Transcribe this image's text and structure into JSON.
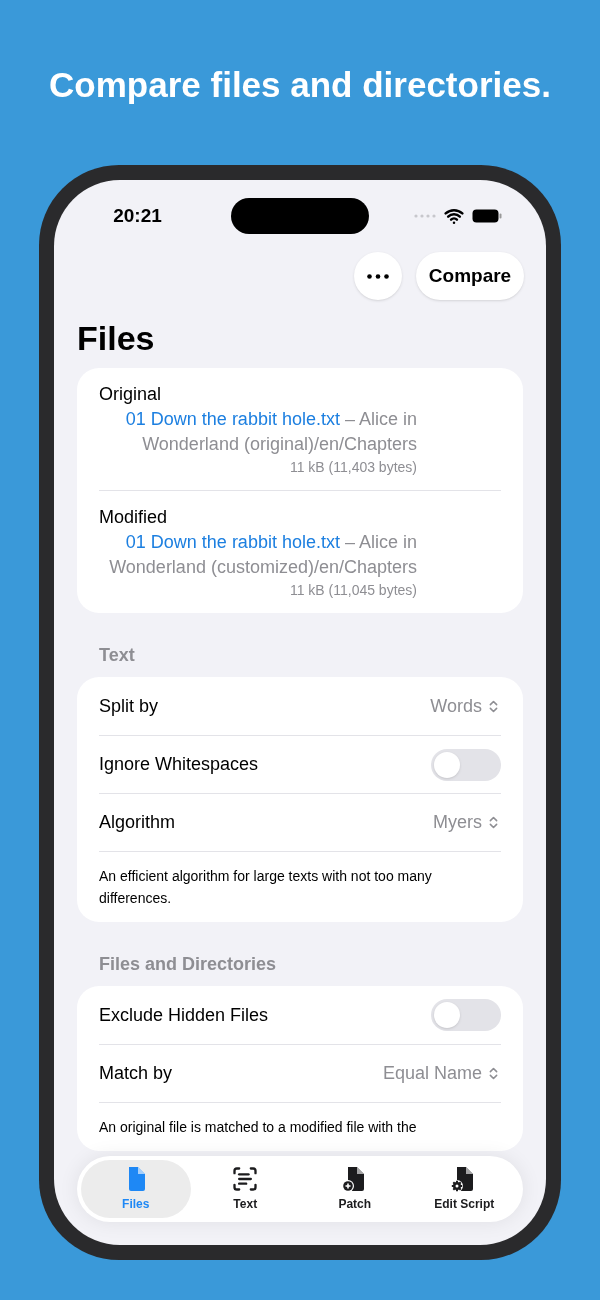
{
  "headline": "Compare files and directories.",
  "status_bar": {
    "time": "20:21"
  },
  "toolbar": {
    "compare_button": "Compare"
  },
  "title": "Files",
  "files": [
    {
      "label": "Original",
      "file_name": "01 Down the rabbit hole.txt",
      "path": " – Alice in Wonderland (original)/en/Chapters",
      "size": "11 kB (11,403 bytes)"
    },
    {
      "label": "Modified",
      "file_name": "01 Down the rabbit hole.txt",
      "path": " – Alice in Wonderland (customized)/en/Chapters",
      "size": "11 kB (11,045 bytes)"
    }
  ],
  "sections": [
    {
      "header": "Text",
      "rows": [
        {
          "kind": "picker",
          "label": "Split by",
          "value": "Words"
        },
        {
          "kind": "toggle",
          "label": "Ignore Whitespaces",
          "on": false
        },
        {
          "kind": "picker",
          "label": "Algorithm",
          "value": "Myers"
        }
      ],
      "footer": "An efficient algorithm for large texts with not too many differences."
    },
    {
      "header": "Files and Directories",
      "rows": [
        {
          "kind": "toggle",
          "label": "Exclude Hidden Files",
          "on": false
        },
        {
          "kind": "picker",
          "label": "Match by",
          "value": "Equal Name"
        }
      ],
      "footer": "An original file is matched to a modified file with the"
    }
  ],
  "tabs": [
    {
      "label": "Files",
      "selected": true
    },
    {
      "label": "Text",
      "selected": false
    },
    {
      "label": "Patch",
      "selected": false
    },
    {
      "label": "Edit Script",
      "selected": false
    }
  ]
}
